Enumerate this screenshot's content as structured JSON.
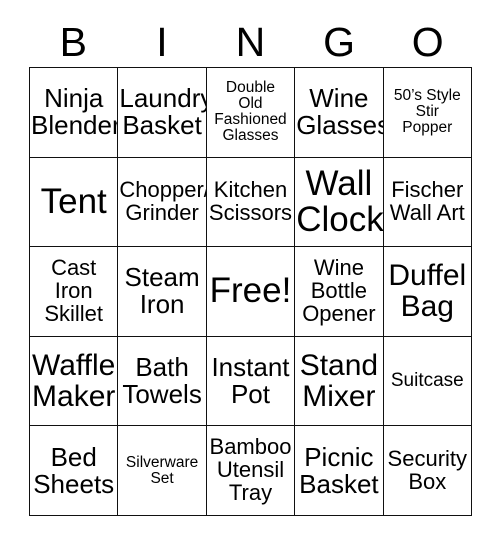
{
  "header": {
    "letters": [
      "B",
      "I",
      "N",
      "G",
      "O"
    ]
  },
  "grid": {
    "rows": [
      [
        {
          "text": "Ninja\nBlender",
          "size": "fs-lg"
        },
        {
          "text": "Laundry\nBasket",
          "size": "fs-lg"
        },
        {
          "text": "Double\nOld\nFashioned\nGlasses",
          "size": "fs-xs"
        },
        {
          "text": "Wine\nGlasses",
          "size": "fs-lg"
        },
        {
          "text": "50’s Style\nStir\nPopper",
          "size": "fs-xs"
        }
      ],
      [
        {
          "text": "Tent",
          "size": "fs-xxl"
        },
        {
          "text": "Chopper/\nGrinder",
          "size": "fs-md"
        },
        {
          "text": "Kitchen\nScissors",
          "size": "fs-md"
        },
        {
          "text": "Wall\nClock",
          "size": "fs-xxl"
        },
        {
          "text": "Fischer\nWall Art",
          "size": "fs-md"
        }
      ],
      [
        {
          "text": "Cast\nIron\nSkillet",
          "size": "fs-md"
        },
        {
          "text": "Steam\nIron",
          "size": "fs-lg"
        },
        {
          "text": "Free!",
          "size": "fs-xxl"
        },
        {
          "text": "Wine\nBottle\nOpener",
          "size": "fs-md"
        },
        {
          "text": "Duffel\nBag",
          "size": "fs-xl"
        }
      ],
      [
        {
          "text": "Waffle\nMaker",
          "size": "fs-xl"
        },
        {
          "text": "Bath\nTowels",
          "size": "fs-lg"
        },
        {
          "text": "Instant\nPot",
          "size": "fs-lg"
        },
        {
          "text": "Stand\nMixer",
          "size": "fs-xl"
        },
        {
          "text": "Suitcase",
          "size": "fs-sm"
        }
      ],
      [
        {
          "text": "Bed\nSheets",
          "size": "fs-lg"
        },
        {
          "text": "Silverware\nSet",
          "size": "fs-xs"
        },
        {
          "text": "Bamboo\nUtensil\nTray",
          "size": "fs-md"
        },
        {
          "text": "Picnic\nBasket",
          "size": "fs-lg"
        },
        {
          "text": "Security\nBox",
          "size": "fs-md"
        }
      ]
    ]
  }
}
